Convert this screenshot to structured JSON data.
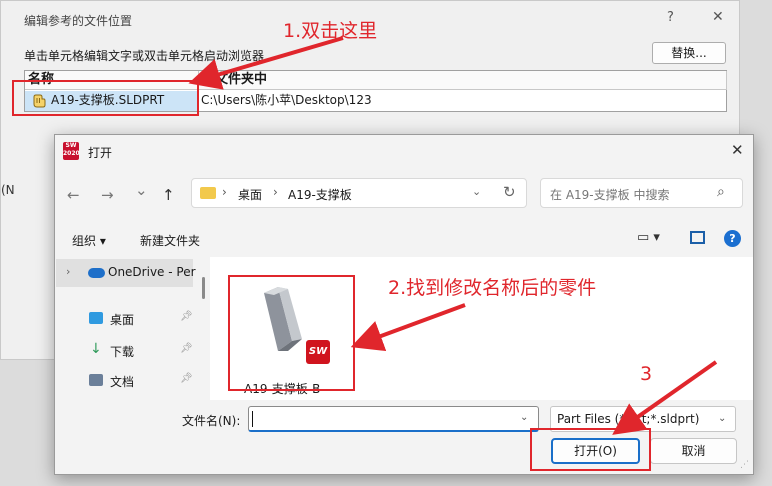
{
  "back_dialog": {
    "title": "编辑参考的文件位置",
    "help": "?",
    "close": "✕",
    "instruction": "单击单元格编辑文字或双击单元格启动浏览器",
    "replace_button": "替换...",
    "columns": [
      "名称",
      "在文件夹中"
    ],
    "row": {
      "name": "A19-支撑板.SLDPRT",
      "folder": "C:\\Users\\陈小苹\\Desktop\\123"
    },
    "left_fragment": "(N"
  },
  "open_dialog": {
    "title": "打开",
    "app_logo": "SW 2020",
    "close": "✕",
    "nav": {
      "back": "←",
      "forward": "→",
      "history": "⌄",
      "up": "↑"
    },
    "address": {
      "desktop": "桌面",
      "folder": "A19-支撑板",
      "sep": "›"
    },
    "search_placeholder": "在 A19-支撑板 中搜索",
    "toolbar": {
      "organize": "组织 ▾",
      "new_folder": "新建文件夹",
      "view": "▭ ▾"
    },
    "sidebar": {
      "onedrive": "OneDrive - Per",
      "items": [
        {
          "label": "桌面",
          "icon": "desktop-icon",
          "color": "#2f9ae0"
        },
        {
          "label": "下载",
          "icon": "download-icon",
          "color": "#2f9a5a"
        },
        {
          "label": "文档",
          "icon": "documents-icon",
          "color": "#6b7f99"
        }
      ]
    },
    "file": {
      "name": "A19-支撑板-B",
      "badge": "SW"
    },
    "filename_label": "文件名(N):",
    "filename_value": "",
    "filter": "Part Files (*.prt;*.sldprt)",
    "open_button": "打开(O)",
    "cancel_button": "取消"
  },
  "annotations": {
    "step1": "1.双击这里",
    "step2": "2.找到修改名称后的零件",
    "step3": "3",
    "color": "#e0262c"
  }
}
